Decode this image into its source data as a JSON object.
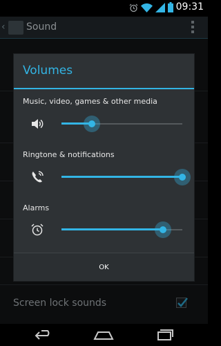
{
  "status_bar": {
    "time": "09:31",
    "icons": [
      "alarm-icon",
      "wifi-icon",
      "signal-icon",
      "battery-icon"
    ]
  },
  "action_bar": {
    "title": "Sound"
  },
  "background": {
    "screen_lock_sounds_label": "Screen lock sounds",
    "screen_lock_sounds_checked": true
  },
  "dialog": {
    "title": "Volumes",
    "accent_color": "#33b5e5",
    "sections": [
      {
        "label": "Music, video, games & other media",
        "icon": "speaker-icon",
        "level_percent": 25
      },
      {
        "label": "Ringtone & notifications",
        "icon": "ringtone-phone-icon",
        "level_percent": 100
      },
      {
        "label": "Alarms",
        "icon": "alarm-clock-icon",
        "level_percent": 84
      }
    ],
    "ok_label": "OK"
  },
  "nav_bar": {
    "buttons": [
      "back-button",
      "home-button",
      "recent-apps-button"
    ]
  }
}
